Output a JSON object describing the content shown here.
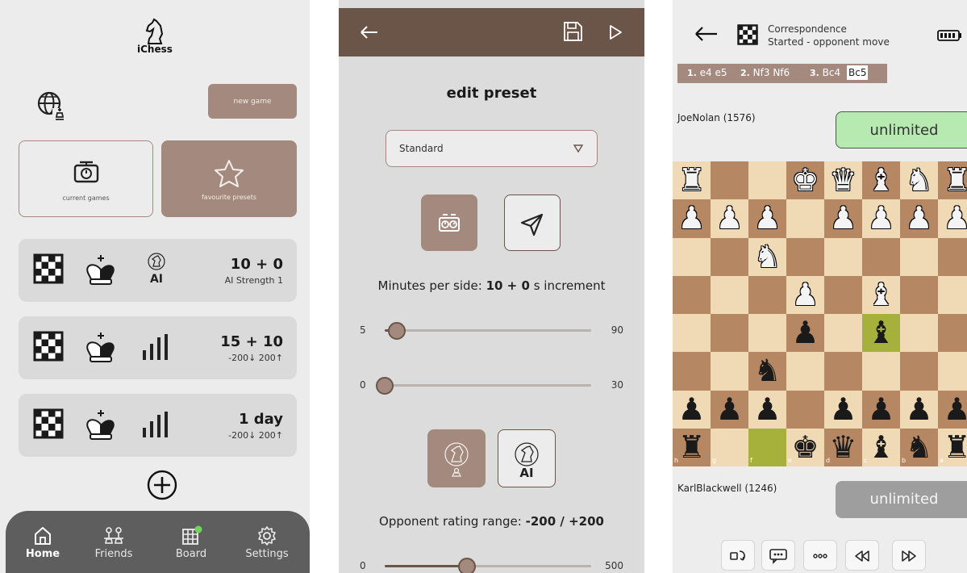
{
  "home": {
    "logo_text": "iChess",
    "new_game_label": "new game",
    "current_games_label": "current games",
    "favourite_presets_label": "favourite presets",
    "presets": [
      {
        "time": "10 + 0",
        "sub": "AI Strength 1",
        "mode": "AI"
      },
      {
        "time": "15 + 10",
        "sub": "-200↓ 200↑",
        "mode": "rating"
      },
      {
        "time": "1 day",
        "sub": "-200↓ 200↑",
        "mode": "rating"
      }
    ],
    "nav": [
      {
        "label": "Home",
        "icon": "home-icon"
      },
      {
        "label": "Friends",
        "icon": "friends-icon"
      },
      {
        "label": "Board",
        "icon": "board-icon"
      },
      {
        "label": "Settings",
        "icon": "settings-icon"
      }
    ]
  },
  "edit": {
    "title": "edit preset",
    "select_value": "Standard",
    "minutes_prefix": "Minutes per side:",
    "minutes_value": "10 + 0",
    "minutes_suffix": "s increment",
    "slider_minutes": {
      "min": "5",
      "max": "90",
      "value": 10
    },
    "slider_increment": {
      "min": "0",
      "max": "30",
      "value": 0
    },
    "ai_label": "AI",
    "rating_prefix": "Opponent rating range:",
    "rating_value": "-200 / +200",
    "slider_rating": {
      "min": "0",
      "max": "500",
      "value": 200
    }
  },
  "game": {
    "mode_title": "Correspondence",
    "status": "Started - opponent move",
    "moves": [
      {
        "num": "1.",
        "text": "e4 e5"
      },
      {
        "num": "2.",
        "text": "Nf3 Nf6"
      },
      {
        "num": "3.",
        "text": "Bc4"
      }
    ],
    "highlighted_move": "Bc5",
    "player_top": "JoeNolan (1576)",
    "player_bottom": "KarlBlackwell (1246)",
    "clock_top": "unlimited",
    "clock_bottom": "unlimited",
    "files": [
      "h",
      "g",
      "f",
      "e",
      "d",
      "c",
      "b",
      "a"
    ]
  },
  "colors": {
    "accent": "#a48a7e",
    "accent_dark": "#6b5448",
    "clock_active": "#b6eab1",
    "board_light": "#f0d9b5",
    "board_dark": "#b58863"
  }
}
